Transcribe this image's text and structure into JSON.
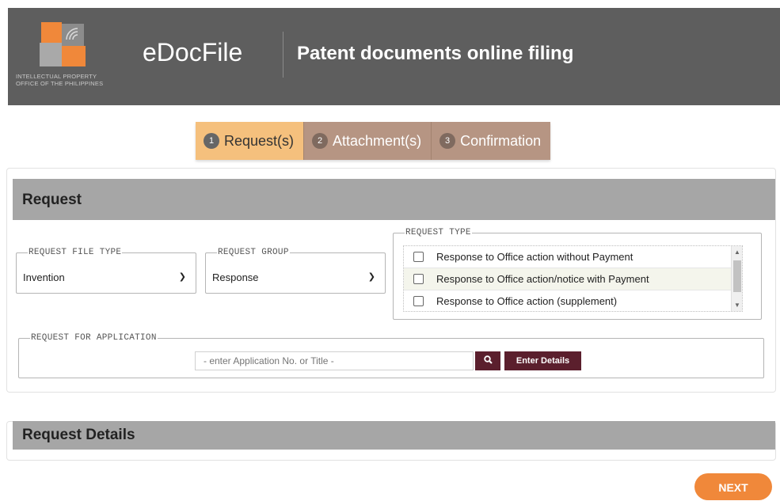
{
  "header": {
    "logo_text_line1": "INTELLECTUAL PROPERTY",
    "logo_text_line2": "OFFICE OF THE PHILIPPINES",
    "app_name": "eDocFile",
    "app_subtitle": "Patent documents online filing"
  },
  "stepper": [
    {
      "num": "1",
      "label": "Request(s)"
    },
    {
      "num": "2",
      "label": "Attachment(s)"
    },
    {
      "num": "3",
      "label": "Confirmation"
    }
  ],
  "request_panel": {
    "title": "Request",
    "file_type": {
      "legend": "REQUEST FILE TYPE",
      "value": "Invention"
    },
    "group": {
      "legend": "REQUEST GROUP",
      "value": "Response"
    },
    "type": {
      "legend": "REQUEST TYPE",
      "options": [
        "Response to Office action without Payment",
        "Response to Office action/notice with Payment",
        "Response to Office action (supplement)"
      ]
    },
    "application": {
      "legend": "REQUEST FOR APPLICATION",
      "placeholder": "- enter Application No. or Title -",
      "enter_details_label": "Enter Details"
    }
  },
  "details_panel": {
    "title": "Request Details"
  },
  "footer": {
    "next_label": "NEXT"
  },
  "colors": {
    "header_bg": "#5e5e5e",
    "accent_orange": "#f0883a",
    "active_step": "#f5c07d",
    "inactive_step": "#b69583",
    "dark_button": "#5b1f2d",
    "panel_head": "#a6a6a6"
  }
}
